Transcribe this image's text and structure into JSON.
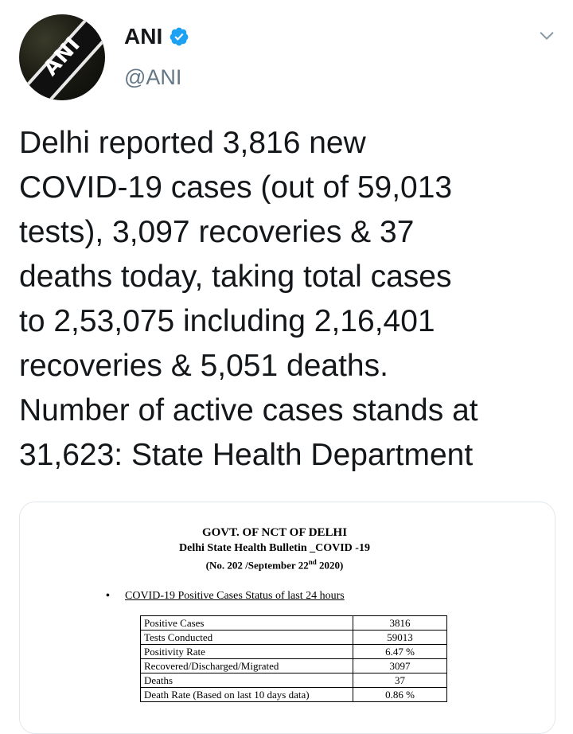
{
  "author": {
    "display_name": "ANI",
    "handle": "@ANI",
    "verified": true,
    "avatar_logo": "ANI"
  },
  "tweet": {
    "text": "Delhi reported 3,816 new\nCOVID-19 cases (out of 59,013\ntests), 3,097 recoveries & 37\ndeaths today, taking total cases\nto 2,53,075 including 2,16,401\nrecoveries & 5,051 deaths.\nNumber of active cases stands at\n31,623: State Health Department"
  },
  "bulletin": {
    "title": "GOVT. OF NCT OF DELHI",
    "subtitle": "Delhi State Health Bulletin _COVID -19",
    "number_prefix": "(No. 202 /September 22",
    "number_sup": "nd",
    "number_suffix": " 2020)",
    "bullet": "•",
    "section_heading": "COVID-19 Positive Cases Status of last 24 hours",
    "rows": [
      {
        "label": "Positive Cases",
        "value": "3816"
      },
      {
        "label": "Tests Conducted",
        "value": "59013"
      },
      {
        "label": "Positivity Rate",
        "value": "6.47 %"
      },
      {
        "label": "Recovered/Discharged/Migrated",
        "value": "3097"
      },
      {
        "label": "Deaths",
        "value": "37"
      },
      {
        "label": "Death Rate (Based on last 10 days data)",
        "value": "0.86 %"
      }
    ]
  },
  "colors": {
    "text_primary": "#14171a",
    "text_secondary": "#657786",
    "verified_blue": "#1da1f2",
    "card_border": "#e1e8ed"
  },
  "icons": {
    "verified": "verified-badge-icon",
    "caret": "chevron-down-icon"
  }
}
